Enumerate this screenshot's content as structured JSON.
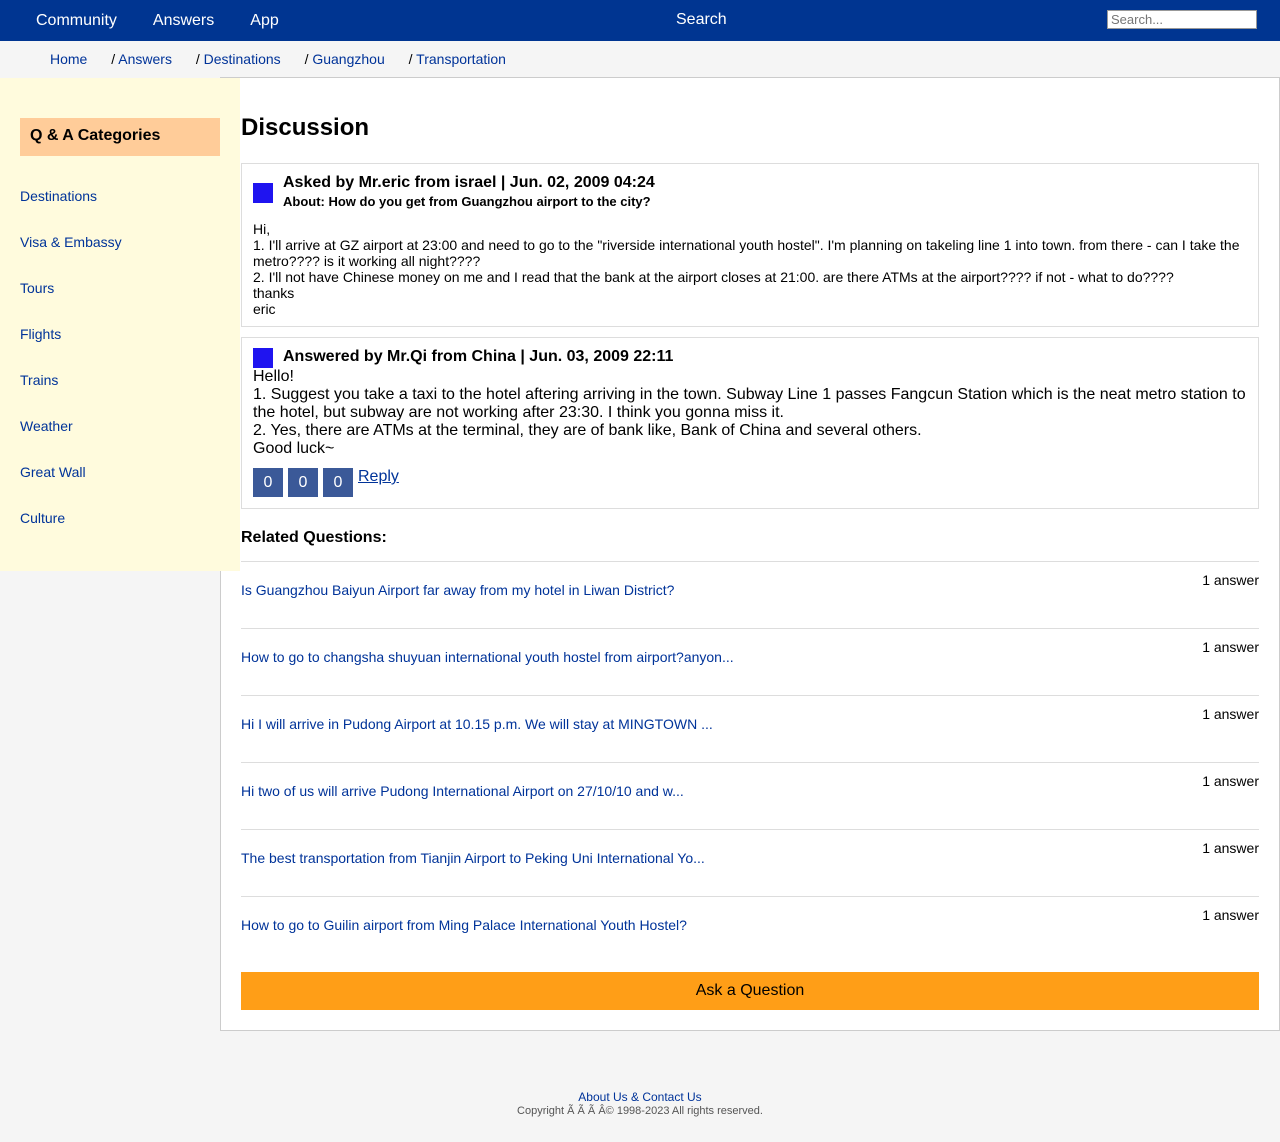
{
  "topnav": {
    "items": [
      "Community",
      "Answers",
      "App"
    ],
    "search_label": "Search",
    "search_placeholder": "Search..."
  },
  "breadcrumb": {
    "items": [
      "Home",
      "Answers",
      "Destinations",
      "Guangzhou",
      "Transportation"
    ],
    "separator": "/"
  },
  "sidebar": {
    "title": "Q & A Categories",
    "items": [
      "Destinations",
      "Visa & Embassy",
      "Tours",
      "Flights",
      "Trains",
      "Weather",
      "Great Wall",
      "Culture"
    ]
  },
  "main": {
    "title": "Discussion",
    "question": {
      "header": "Asked by Mr.eric from israel | Jun. 02, 2009 04:24",
      "about": "About: How do you get from Guangzhou airport to the city?",
      "body": [
        "Hi,",
        "1. I'll arrive at GZ airport at 23:00 and need to go to the \"riverside international youth hostel\". I'm planning on takeling line 1 into town. from there - can I take the metro???? is it working all night????",
        "2. I'll not have Chinese money on me and I read that the bank at the airport closes at 21:00. are there ATMs at the airport???? if not - what to do????",
        "thanks",
        "eric"
      ]
    },
    "answer": {
      "header": "Answered by Mr.Qi from China | Jun. 03, 2009 22:11",
      "body": [
        "Hello!",
        "1. Suggest you take a taxi to the hotel aftering arriving in the town. Subway Line 1 passes Fangcun Station which is the neat metro station to the hotel, but subway are not working after 23:30. I think you gonna miss it.",
        "2. Yes, there are ATMs at the terminal, they are of bank like, Bank of China and several others.",
        "Good luck~"
      ],
      "votes": [
        "0",
        "0",
        "0"
      ],
      "reply_label": "Reply"
    },
    "related": {
      "title": "Related Questions:",
      "items": [
        {
          "text": "Is Guangzhou Baiyun Airport far away from my hotel in Liwan District?",
          "count": "1 answer"
        },
        {
          "text": "How to go to changsha shuyuan international youth hostel from airport?anyon...",
          "count": "1 answer"
        },
        {
          "text": "Hi I will arrive in Pudong Airport at 10.15 p.m. We will stay at MINGTOWN ...",
          "count": "1 answer"
        },
        {
          "text": "Hi two of us will arrive Pudong International Airport on 27/10/10 and w...",
          "count": "1 answer"
        },
        {
          "text": "The best transportation from Tianjin Airport to Peking Uni International Yo...",
          "count": "1 answer"
        },
        {
          "text": "How to go to Guilin airport from Ming Palace International Youth Hostel?",
          "count": "1 answer"
        }
      ]
    },
    "ask_button": "Ask a Question"
  },
  "footer": {
    "link": "About Us & Contact Us",
    "copyright": "Copyright Ã Ã Ã Â© 1998-2023 All rights reserved."
  },
  "colors": {
    "topbar": "#003591",
    "sidebar_bg": "#fffbdd",
    "sidebar_title_bg": "#ffcc99",
    "avatar": "#1f14f0",
    "vote_bg": "#3b5998",
    "ask_button": "#ff9e17",
    "link": "#003399"
  }
}
